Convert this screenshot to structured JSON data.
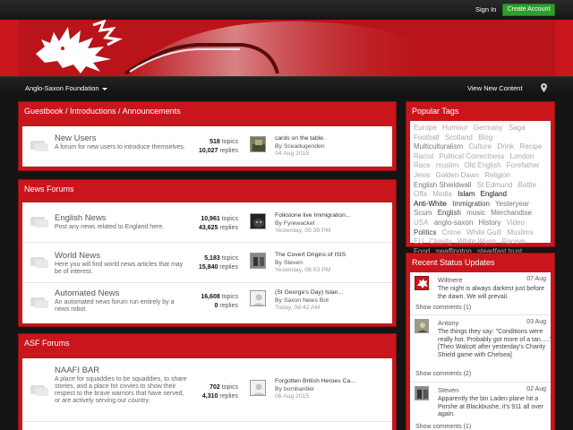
{
  "topbar": {
    "sign_in": "Sign In",
    "create_account": "Create Account"
  },
  "nav": {
    "forum_name": "Anglo-Saxon Foundation",
    "view_new_content": "View New Content"
  },
  "colors": {
    "brand_red": "#c8161c",
    "dark": "#141414",
    "create_green": "#2f9e2f"
  },
  "sections": [
    {
      "title": "Guestbook / Introductions / Announcements",
      "forums": [
        {
          "title": "New Users",
          "description": "A forum for new users to introduce themselves.",
          "topics": "518",
          "topics_label": "topics",
          "replies": "10,027",
          "replies_label": "replies",
          "last_title": "cards on the table.",
          "last_by": "By Sceadugenden",
          "last_date": "04 Aug 2015"
        }
      ]
    },
    {
      "title": "News Forums",
      "forums": [
        {
          "title": "English News",
          "description": "Post any news related to England here.",
          "topics": "10,961",
          "topics_label": "topics",
          "replies": "43,625",
          "replies_label": "replies",
          "last_title": "Folkstone live Immigration...",
          "last_by": "By Fyrewacket",
          "last_date": "Yesterday, 05:39 PM"
        },
        {
          "title": "World News",
          "description": "Here you will find world news articles that may be of interest.",
          "topics": "5,183",
          "topics_label": "topics",
          "replies": "15,840",
          "replies_label": "replies",
          "last_title": "The Covert Origins of ISIS",
          "last_by": "By Steven",
          "last_date": "Yesterday, 08:53 PM"
        },
        {
          "title": "Automated News",
          "description": "An automated news forum run entirely by a news robot.",
          "topics": "16,608",
          "topics_label": "topics",
          "replies": "0",
          "replies_label": "replies",
          "last_title": "(St George's Day) Islan...",
          "last_by": "By Saxon News Bot",
          "last_date": "Today, 08:42 AM"
        }
      ]
    },
    {
      "title": "ASF Forums",
      "forums": [
        {
          "title": "NAAFI BAR",
          "description": "A place for squaddies to be squaddies, to share stories, and a place for civvies to show their respect to the brave warriors that have served, or are actively serving our country.",
          "topics": "702",
          "topics_label": "topics",
          "replies": "4,310",
          "replies_label": "replies",
          "last_title": "Forgotten British Heroes Ca...",
          "last_by": "By bombardier",
          "last_date": "06 Aug 2015"
        }
      ]
    }
  ],
  "popular_tags": {
    "title": "Popular Tags",
    "tags": [
      {
        "t": "Europe",
        "w": "l"
      },
      {
        "t": "Humour",
        "w": "l"
      },
      {
        "t": "Germany",
        "w": "l"
      },
      {
        "t": "Saga",
        "w": "l"
      },
      {
        "t": "Football",
        "w": "l"
      },
      {
        "t": "Scotland",
        "w": "l"
      },
      {
        "t": "Blog",
        "w": "l"
      },
      {
        "t": "Multiculturalism",
        "w": "m"
      },
      {
        "t": "Culture",
        "w": "l"
      },
      {
        "t": "Drink",
        "w": "l"
      },
      {
        "t": "Recipe",
        "w": "l"
      },
      {
        "t": "Racist",
        "w": "l"
      },
      {
        "t": "Political Correctness",
        "w": "l"
      },
      {
        "t": "London",
        "w": "l"
      },
      {
        "t": "Race",
        "w": "l"
      },
      {
        "t": "muslim",
        "w": "l"
      },
      {
        "t": "Old English",
        "w": "l"
      },
      {
        "t": "Forefather",
        "w": "l"
      },
      {
        "t": "Jews",
        "w": "l"
      },
      {
        "t": "Golden Dawn",
        "w": "l"
      },
      {
        "t": "Religion",
        "w": "l"
      },
      {
        "t": "English Shieldwall",
        "w": "m"
      },
      {
        "t": "St Edmund",
        "w": "l"
      },
      {
        "t": "Battle",
        "w": "l"
      },
      {
        "t": "Offa",
        "w": "l"
      },
      {
        "t": "Media",
        "w": "l"
      },
      {
        "t": "Islam",
        "w": "dd"
      },
      {
        "t": "England",
        "w": "dd"
      },
      {
        "t": "Anti-White",
        "w": "dd"
      },
      {
        "t": "Immigration",
        "w": "d"
      },
      {
        "t": "Yesteryear",
        "w": "m"
      },
      {
        "t": "Scum",
        "w": "m"
      },
      {
        "t": "English",
        "w": "d"
      },
      {
        "t": "music",
        "w": "m"
      },
      {
        "t": "Merchandise",
        "w": "m"
      },
      {
        "t": "USA",
        "w": "l"
      },
      {
        "t": "anglo-saxon",
        "w": "m"
      },
      {
        "t": "History",
        "w": "m"
      },
      {
        "t": "Video",
        "w": "l"
      },
      {
        "t": "Politics",
        "w": "d"
      },
      {
        "t": "Crime",
        "w": "l"
      },
      {
        "t": "White Guilt",
        "w": "l"
      },
      {
        "t": "Muslims",
        "w": "l"
      },
      {
        "t": "EU",
        "w": "l"
      },
      {
        "t": "Charity",
        "w": "l"
      },
      {
        "t": "White Wynn",
        "w": "l"
      },
      {
        "t": "Racism",
        "w": "l"
      },
      {
        "t": "Food",
        "w": "l"
      },
      {
        "t": "swaffington",
        "w": "l"
      },
      {
        "t": "steadfast trust",
        "w": "l"
      }
    ]
  },
  "status_updates": {
    "title": "Recent Status Updates",
    "items": [
      {
        "name": "Wiltnere",
        "date": "07 Aug",
        "text": "The night is always darkest just before the dawn. We will prevail.",
        "comments": "Show comments (1)"
      },
      {
        "name": "Antony",
        "date": "03 Aug",
        "text": "The things they say: \"Conditions were really hot. Probably got more of a tan.....\" [Theo Walcott after yesterday's Charity Shield game with Chelsea]",
        "comments": "Show comments (2)"
      },
      {
        "name": "Steven",
        "date": "02 Aug",
        "text": "Apparently the bin Laden plane hit a Porshe at Blackbushe, it's 911 all over again.",
        "comments": "Show comments (1)"
      }
    ]
  }
}
